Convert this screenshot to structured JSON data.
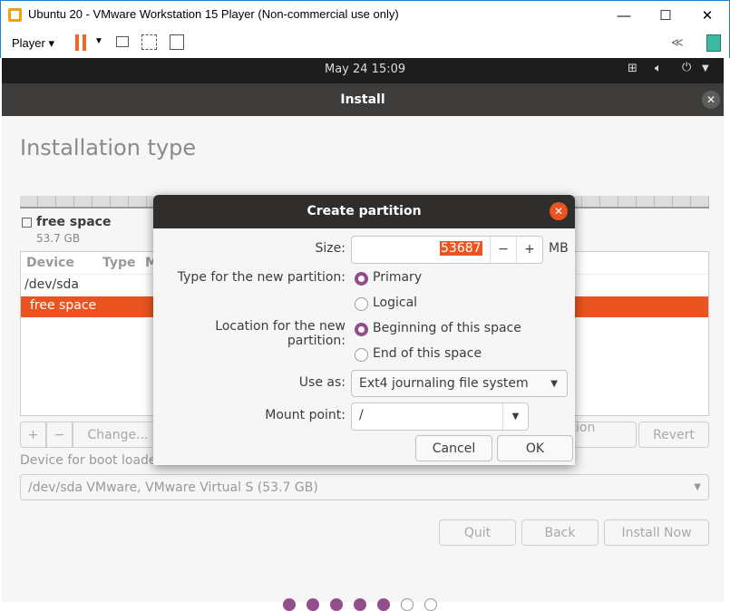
{
  "window": {
    "title": "Ubuntu 20 - VMware Workstation 15 Player (Non-commercial use only)",
    "min": "—",
    "max": "☐",
    "close": "✕"
  },
  "toolbar": {
    "player_label": "Player ▾",
    "collapse": "≪"
  },
  "topbar": {
    "datetime": "May 24  15:09"
  },
  "install": {
    "title": "Install",
    "page_title": "Installation type",
    "disk": {
      "label": "free space",
      "size": "53.7 GB"
    },
    "table": {
      "headers": [
        "Device",
        "Type",
        "M"
      ],
      "rows": [
        "/dev/sda",
        "free space"
      ]
    },
    "buttons": {
      "add": "+",
      "remove": "−",
      "change": "Change...",
      "new_table": "New Partition Table...",
      "revert": "Revert"
    },
    "bootloader_label": "Device for boot loader installation:",
    "bootloader_value": "/dev/sda VMware, VMware Virtual S (53.7 GB)",
    "nav": {
      "quit": "Quit",
      "back": "Back",
      "install_now": "Install Now"
    }
  },
  "dialog": {
    "title": "Create partition",
    "size_label": "Size:",
    "size_value": "53687",
    "size_unit": "MB",
    "minus": "−",
    "plus": "+",
    "type_label": "Type for the new partition:",
    "type_options": [
      "Primary",
      "Logical"
    ],
    "type_selected": "Primary",
    "location_label": "Location for the new partition:",
    "location_options": [
      "Beginning of this space",
      "End of this space"
    ],
    "location_selected": "Beginning of this space",
    "use_as_label": "Use as:",
    "use_as_value": "Ext4 journaling file system",
    "mount_label": "Mount point:",
    "mount_value": "/",
    "cancel": "Cancel",
    "ok": "OK"
  },
  "colors": {
    "accent": "#e95420",
    "radio": "#924d8b",
    "header": "#3d3c3b"
  }
}
